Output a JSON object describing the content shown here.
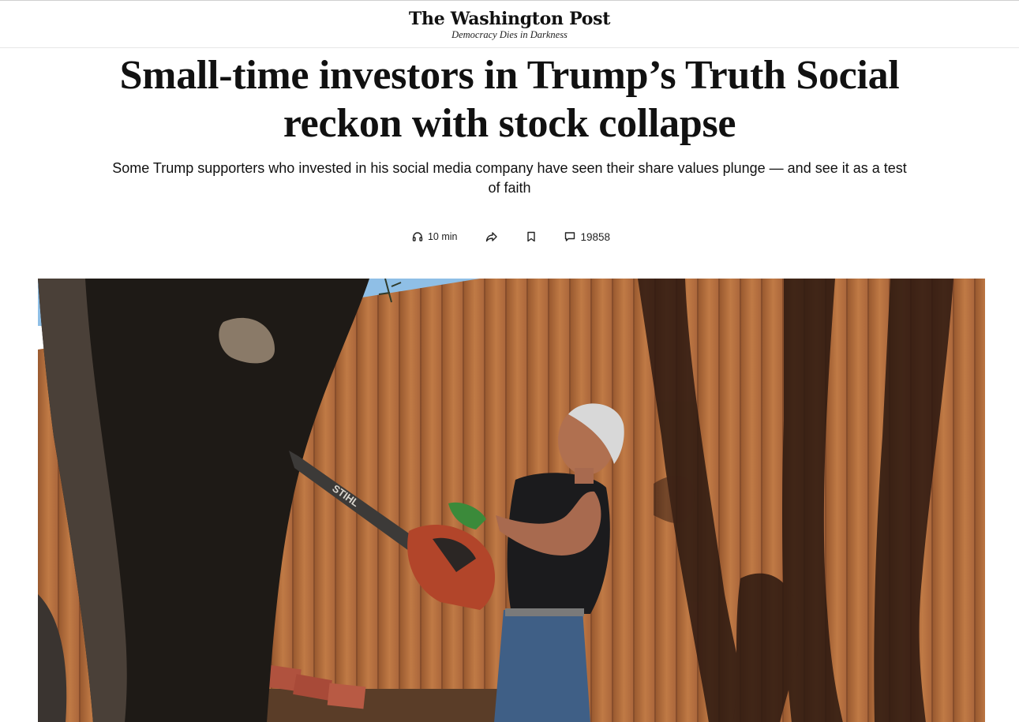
{
  "masthead": {
    "logo": "The Washington Post",
    "tagline": "Democracy Dies in Darkness"
  },
  "article": {
    "headline": "Small-time investors in Trump’s Truth Social reckon with stock collapse",
    "dek": "Some Trump supporters who invested in his social media company have seen their share values plunge — and see it as a test of faith"
  },
  "actions": {
    "listen_label": "10 min",
    "share_icon": "share-icon",
    "bookmark_icon": "bookmark-icon",
    "comments_count": "19858"
  },
  "hero": {
    "chainsaw_brand": "STIHL"
  },
  "colors": {
    "fence": "#b06a3c",
    "fence_shadow": "#3a2216",
    "sky": "#8fbfe6",
    "text": "#111111"
  }
}
